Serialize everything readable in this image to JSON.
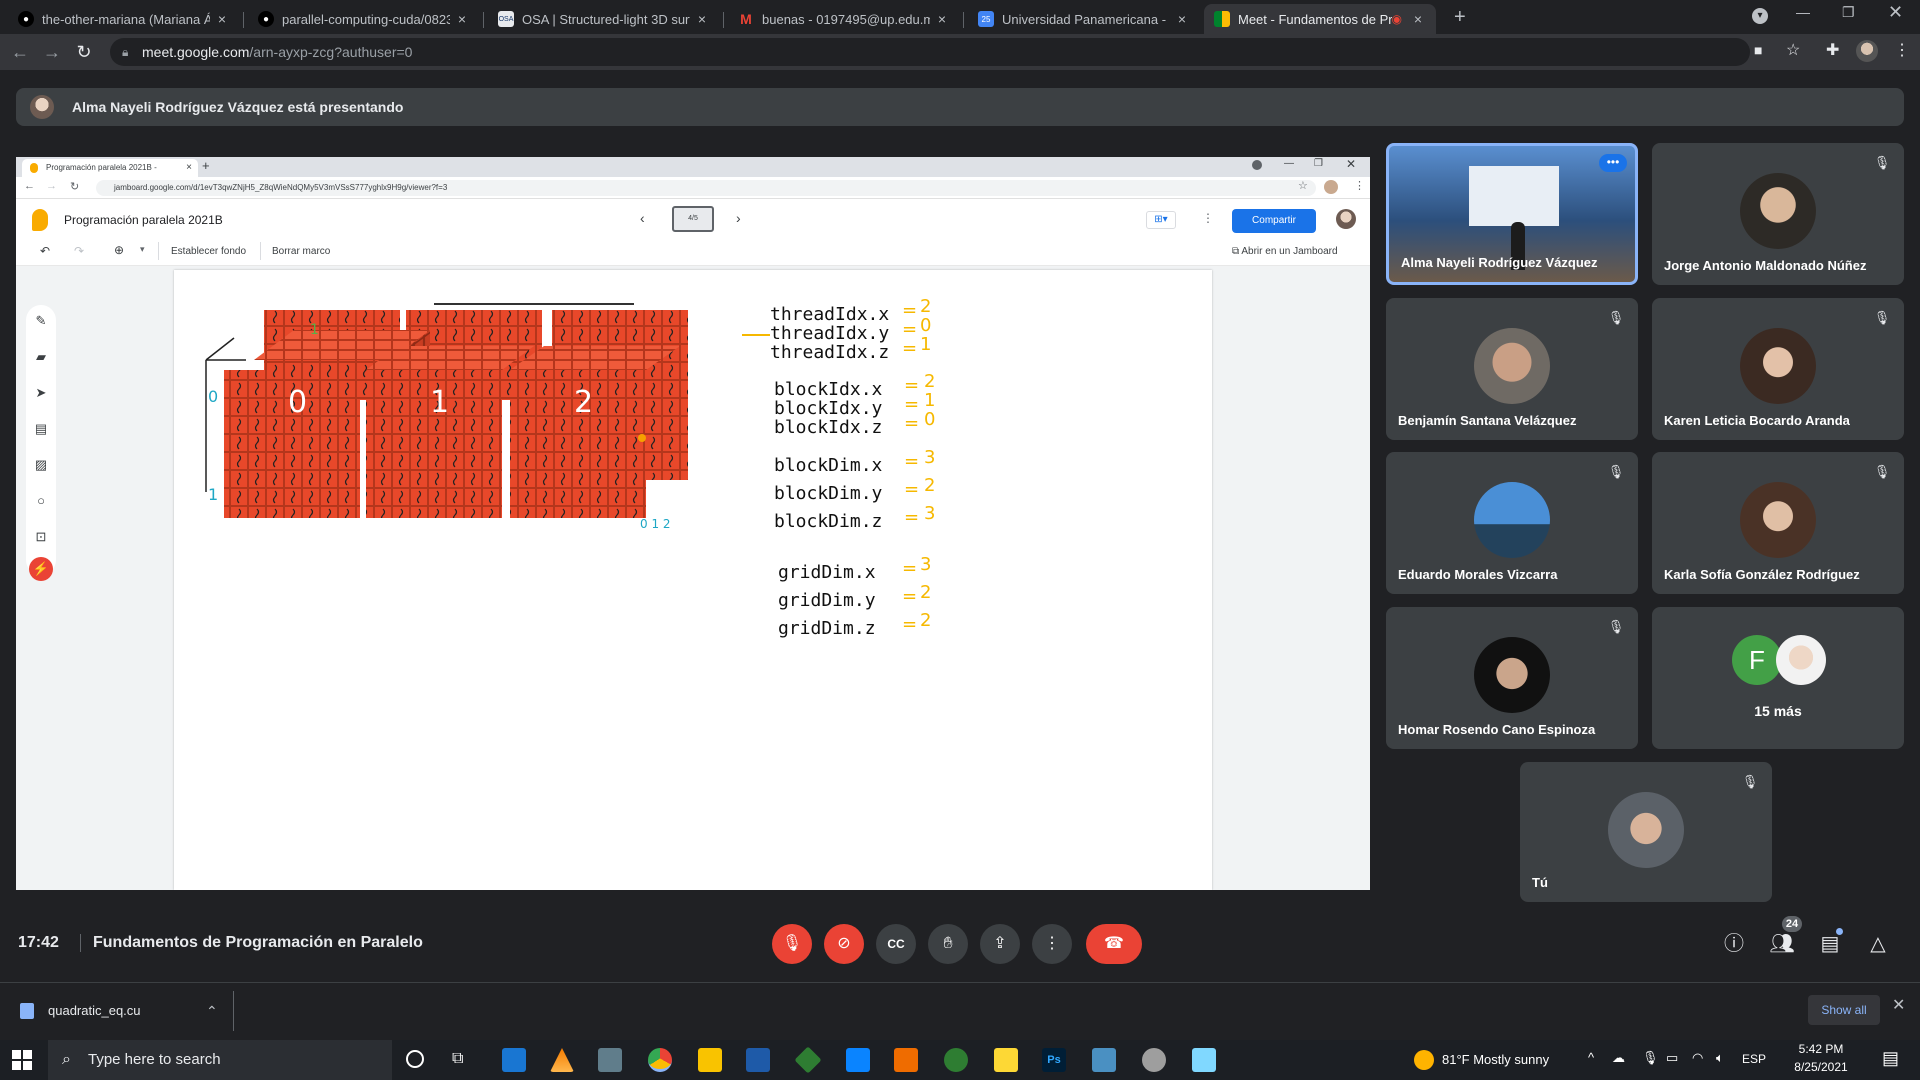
{
  "browser": {
    "tabs": [
      {
        "label": "the-other-mariana (Mariana Ával",
        "icon": "github-icon"
      },
      {
        "label": "parallel-computing-cuda/082320",
        "icon": "github-icon"
      },
      {
        "label": "OSA | Structured-light 3D surface",
        "icon": "osa-icon"
      },
      {
        "label": "buenas - 0197495@up.edu.mx -",
        "icon": "gmail-icon"
      },
      {
        "label": "Universidad Panamericana - Cale",
        "icon": "calendar-icon"
      },
      {
        "label": "Meet - Fundamentos de Pro",
        "icon": "meet-icon",
        "active": true
      }
    ],
    "new_tab": "+",
    "url_host": "meet.google.com",
    "url_path": "/arn-ayxp-zcg?authuser=0"
  },
  "banner": {
    "text": "Alma Nayeli Rodríguez Vázquez está presentando"
  },
  "shared": {
    "inner_tab": "Programación paralela 2021B - ",
    "inner_url": "jamboard.google.com/d/1evT3qwZNjH5_Z8qWieNdQMy5V3mVSsS777yghlx9H9g/viewer?f=3",
    "jam_title": "Programación paralela 2021B",
    "page_indicator": "4/5",
    "share_button": "Compartir",
    "tools": {
      "set_background": "Establecer fondo",
      "clear_frame": "Borrar marco",
      "open_in_jamboard": "Abrir en un Jamboard"
    },
    "code_lines": [
      {
        "label": "threadIdx.x",
        "value": "2"
      },
      {
        "label": "threadIdx.y",
        "value": "0"
      },
      {
        "label": "threadIdx.z",
        "value": "1"
      },
      {
        "label": "blockIdx.x",
        "value": "2"
      },
      {
        "label": "blockIdx.y",
        "value": "1"
      },
      {
        "label": "blockIdx.z",
        "value": "0"
      },
      {
        "label": "blockDim.x",
        "value": "3"
      },
      {
        "label": "blockDim.y",
        "value": "2"
      },
      {
        "label": "blockDim.z",
        "value": "3"
      },
      {
        "label": "gridDim.x",
        "value": "3"
      },
      {
        "label": "gridDim.y",
        "value": "2"
      },
      {
        "label": "gridDim.z",
        "value": "2"
      }
    ],
    "block_labels": [
      "0",
      "1",
      "2"
    ]
  },
  "participants": [
    {
      "name": "Alma Nayeli Rodríguez Vázquez",
      "presenting": true
    },
    {
      "name": "Jorge Antonio Maldonado Núñez",
      "muted": true
    },
    {
      "name": "Benjamín Santana Velázquez",
      "muted": true
    },
    {
      "name": "Karen Leticia Bocardo Aranda",
      "muted": true
    },
    {
      "name": "Eduardo Morales Vizcarra",
      "muted": true
    },
    {
      "name": "Karla Sofía González Rodríguez",
      "muted": true
    },
    {
      "name": "Homar Rosendo Cano Espinoza",
      "muted": true
    },
    {
      "name": "15 más",
      "initial": "F"
    },
    {
      "name": "Tú",
      "muted": true
    }
  ],
  "meeting": {
    "time": "17:42",
    "title": "Fundamentos de Programación en Paralelo",
    "people_count": "24"
  },
  "downloads": {
    "file": "quadratic_eq.cu",
    "show_all": "Show all"
  },
  "taskbar": {
    "search_placeholder": "Type here to search",
    "weather": "81°F  Mostly sunny",
    "lang": "ESP",
    "time": "5:42 PM",
    "date": "8/25/2021"
  },
  "colors": {
    "brick": "#e8482a",
    "meet_red": "#ea4335",
    "blue": "#1a73e8",
    "handwriting": "#f6b800"
  }
}
